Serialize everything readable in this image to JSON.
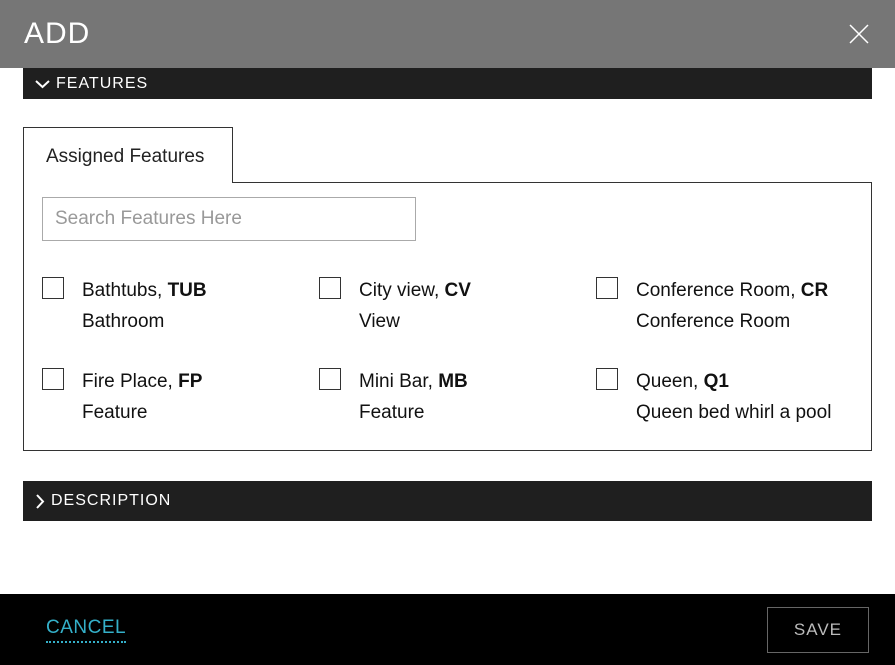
{
  "modal": {
    "title": "ADD"
  },
  "sections": {
    "features_title": "FEATURES",
    "description_title": "DESCRIPTION"
  },
  "tabs": {
    "assigned_features": "Assigned Features"
  },
  "search": {
    "placeholder": "Search Features Here"
  },
  "features": [
    {
      "name": "Bathtubs",
      "code": "TUB",
      "desc": "Bathroom"
    },
    {
      "name": "City view",
      "code": "CV",
      "desc": "View"
    },
    {
      "name": "Conference Room",
      "code": "CR",
      "desc": "Conference Room"
    },
    {
      "name": "Fire Place",
      "code": "FP",
      "desc": "Feature"
    },
    {
      "name": "Mini Bar",
      "code": "MB",
      "desc": "Feature"
    },
    {
      "name": "Queen",
      "code": "Q1",
      "desc": "Queen bed whirl a pool"
    }
  ],
  "footer": {
    "cancel_label": "CANCEL",
    "save_label": "SAVE"
  }
}
